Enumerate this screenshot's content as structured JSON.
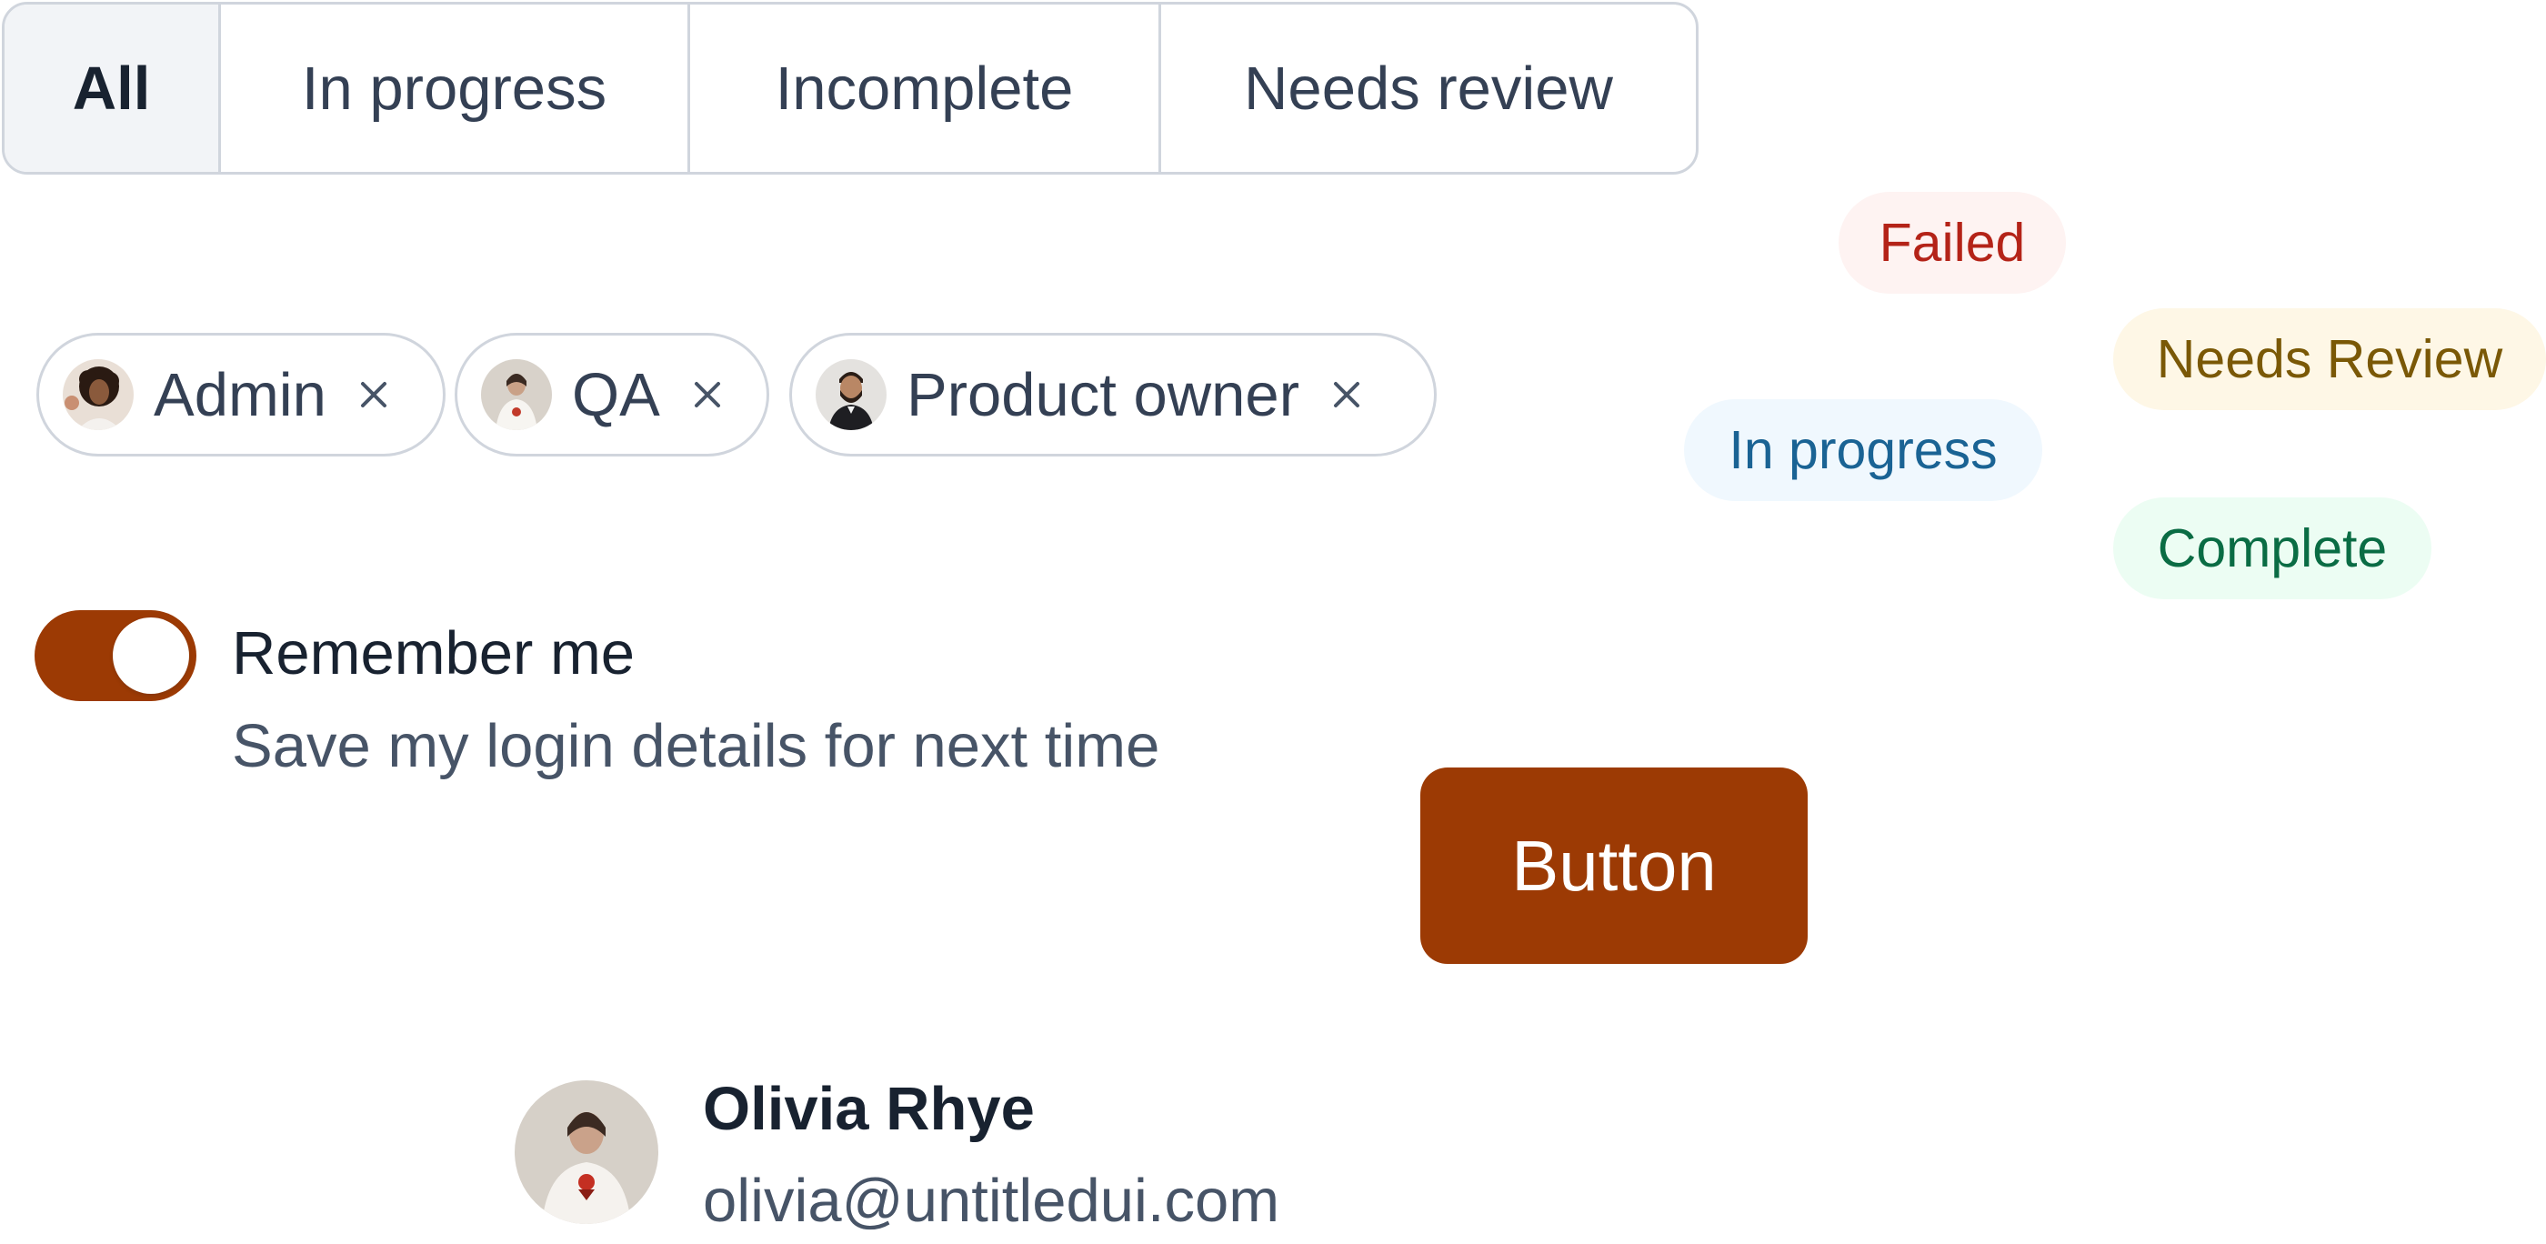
{
  "tabs": {
    "items": [
      {
        "label": "All",
        "active": true
      },
      {
        "label": "In progress",
        "active": false
      },
      {
        "label": "Incomplete",
        "active": false
      },
      {
        "label": "Needs review",
        "active": false
      }
    ]
  },
  "chips": [
    {
      "label": "Admin",
      "avatar": "woman-curly-hair-avatar",
      "close_icon": "close-icon"
    },
    {
      "label": "QA",
      "avatar": "woman-white-outfit-avatar",
      "close_icon": "close-icon"
    },
    {
      "label": "Product owner",
      "avatar": "man-beard-avatar",
      "close_icon": "close-icon"
    }
  ],
  "badges": {
    "failed": {
      "label": "Failed",
      "color": "#b42318",
      "bg": "#fef3f2"
    },
    "needs_review": {
      "label": "Needs Review",
      "color": "#7a5806",
      "bg": "#fef7e6"
    },
    "in_progress": {
      "label": "In progress",
      "color": "#1a6394",
      "bg": "#f0f8fe"
    },
    "complete": {
      "label": "Complete",
      "color": "#0a6c44",
      "bg": "#ecfdf3"
    }
  },
  "toggle": {
    "on": true,
    "title": "Remember me",
    "description": "Save my login details for next time"
  },
  "button": {
    "label": "Button"
  },
  "user": {
    "name": "Olivia Rhye",
    "email": "olivia@untitledui.com",
    "avatar": "olivia-avatar"
  },
  "colors": {
    "brand": "#9c3a04",
    "border": "#d0d5dd",
    "text_primary": "#182230",
    "text_secondary": "#475467"
  }
}
